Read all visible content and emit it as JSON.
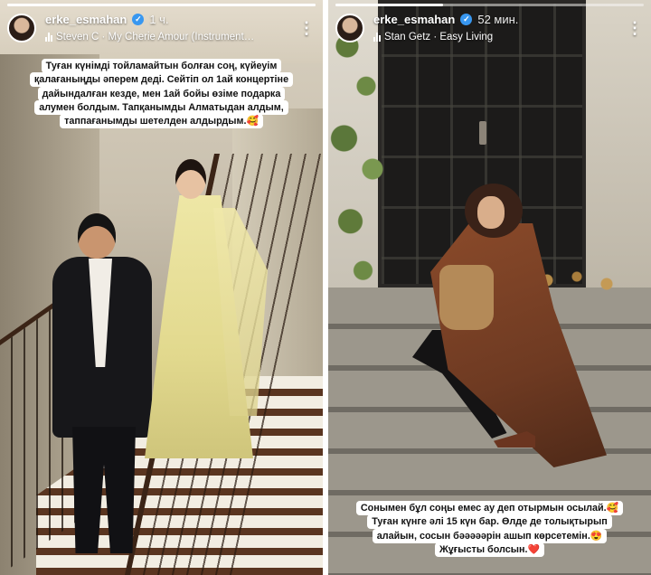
{
  "stories": [
    {
      "username": "erke_esmahan",
      "time_ago": "1 ч.",
      "music": "Steven C · My Cherie Amour (Instrument…",
      "caption_lines": [
        "Туған күнімді тойламайтын болған соң, күйеуім",
        "қалағаныңды әперем деді. Сейтіп ол 1ай концертіне",
        "дайындалған кезде, мен 1ай бойы өзіме подарка",
        "алумен болдым. Тапқанымды Алматыдан алдым,",
        "таппағанымды шетелден алдырдым.🥰"
      ],
      "progress": 1
    },
    {
      "username": "erke_esmahan",
      "time_ago": "52 мин.",
      "music": "Stan Getz · Easy Living",
      "caption_lines": [
        "Сонымен бұл соңы емес ау деп отырмын осылай.🥰",
        "Туған күнге әлі 15 күн бар. Өлде де толықтырып",
        "алайын, сосын бәәәәәрін ашып көрсетемін.😍",
        "Жұғысты болсын.❤️"
      ],
      "progress": 0.35
    }
  ],
  "icons": {
    "verified": "verified-badge-icon",
    "music": "music-bars-icon",
    "more": "more-vertical-icon"
  },
  "colors": {
    "verified": "#3897f0",
    "caption_bg": "#ffffff",
    "caption_text": "#121212"
  }
}
